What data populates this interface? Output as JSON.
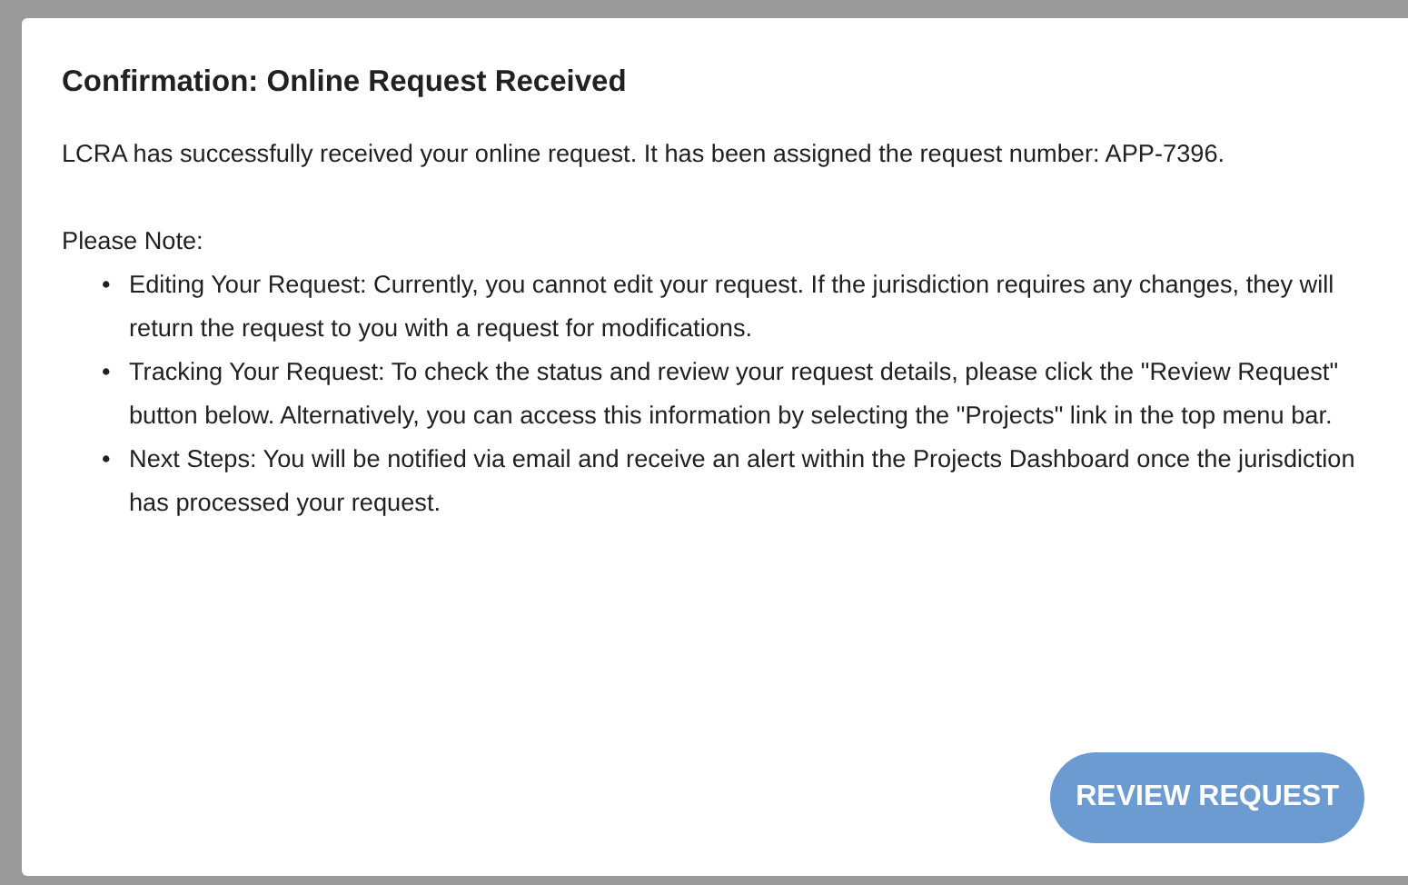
{
  "dialog": {
    "title": "Confirmation: Online Request Received",
    "message": "LCRA has successfully received your online request. It has been assigned the request number: APP-7396.",
    "note_heading": "Please Note:",
    "notes": [
      {
        "bullet": "•",
        "text": "Editing Your Request: Currently, you cannot edit your request. If the jurisdiction requires any changes, they will return the request to you with a request for modifications."
      },
      {
        "bullet": "•",
        "text": "Tracking Your Request: To check the status and review your request details, please click the \"Review Request\" button below. Alternatively, you can access this information by selecting the \"Projects\" link in the top menu bar."
      },
      {
        "bullet": "•",
        "text": "Next Steps: You will be notified via email and receive an alert within the Projects Dashboard once the jurisdiction has processed your request."
      }
    ],
    "buttons": [
      "REVIEW REQUEST"
    ]
  }
}
